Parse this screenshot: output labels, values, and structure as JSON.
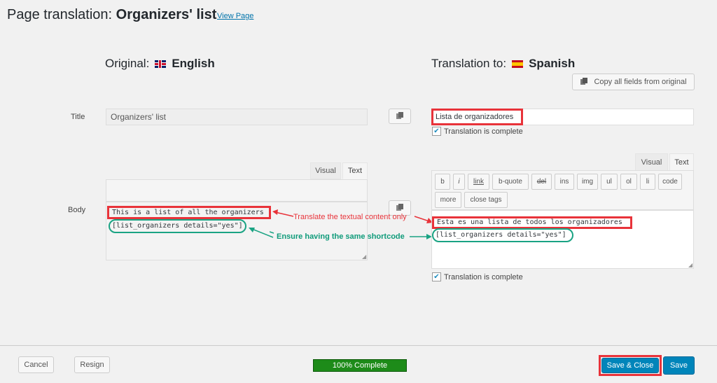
{
  "header": {
    "title_prefix": "Page translation: ",
    "title_name": "Organizers' list",
    "view_page": "View Page"
  },
  "original": {
    "label": "Original:",
    "language": "English",
    "flag": "uk-flag"
  },
  "translation": {
    "label": "Translation to:",
    "language": "Spanish",
    "flag": "spain-flag",
    "copy_all": "Copy all fields from original"
  },
  "fields": {
    "title_label": "Title",
    "body_label": "Body",
    "original_title": "Organizers' list",
    "translated_title": "Lista de organizadores",
    "complete_label": "Translation is complete"
  },
  "editor": {
    "tab_visual": "Visual",
    "tab_text": "Text",
    "original_line1": "This is a list of all the organizers",
    "original_line2": "[list_organizers details=\"yes\"]",
    "translated_line1": "Esta es una lista de todos los organizadores",
    "translated_line2": "[list_organizers details=\"yes\"]",
    "quicktags": [
      "b",
      "i",
      "link",
      "b-quote",
      "del",
      "ins",
      "img",
      "ul",
      "ol",
      "li",
      "code",
      "more",
      "close tags"
    ]
  },
  "annotations": {
    "translate_note": "Translate the textual content only",
    "shortcode_note": "Ensure having the same shortcode"
  },
  "footer": {
    "cancel": "Cancel",
    "resign": "Resign",
    "progress": "100% Complete",
    "progress_fraction": 1.0,
    "save_close": "Save & Close",
    "save": "Save"
  },
  "colors": {
    "annotation_red": "#e8333a",
    "annotation_green": "#1aa383",
    "progress_green": "#1d8b19",
    "primary_blue": "#0085ba"
  }
}
